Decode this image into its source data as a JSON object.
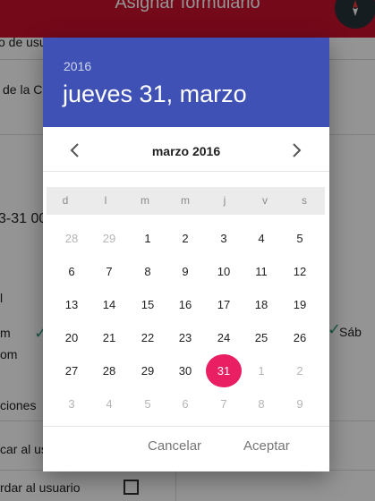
{
  "app": {
    "title": "Asignar formulario",
    "background_fragments": {
      "f1": "o de usu",
      "f2": "de la C",
      "f3": "3-31 00",
      "f4": "l",
      "f5": "m",
      "f6": "om",
      "f7": "Sáb",
      "f8": "ciones",
      "f9": "car al usu",
      "f10": "rdar al usuario"
    }
  },
  "colors": {
    "app_bar": "#c8102e",
    "dialog_header": "#3f51b5",
    "selected_day": "#e91e63"
  },
  "dialog": {
    "year": "2016",
    "date_title": "jueves 31, marzo",
    "month_label": "marzo 2016",
    "weekdays": [
      "d",
      "l",
      "m",
      "m",
      "j",
      "v",
      "s"
    ],
    "weeks": [
      [
        "28",
        "29",
        "1",
        "2",
        "3",
        "4",
        "5"
      ],
      [
        "6",
        "7",
        "8",
        "9",
        "10",
        "11",
        "12"
      ],
      [
        "13",
        "14",
        "15",
        "16",
        "17",
        "18",
        "19"
      ],
      [
        "20",
        "21",
        "22",
        "23",
        "24",
        "25",
        "26"
      ],
      [
        "27",
        "28",
        "29",
        "30",
        "31",
        "1",
        "2"
      ],
      [
        "3",
        "4",
        "5",
        "6",
        "7",
        "8",
        "9"
      ]
    ],
    "buttons": {
      "cancel": "Cancelar",
      "accept": "Aceptar"
    },
    "icons": {
      "prev": "chevron-left-icon",
      "next": "chevron-right-icon",
      "fab": "compass-icon"
    }
  }
}
